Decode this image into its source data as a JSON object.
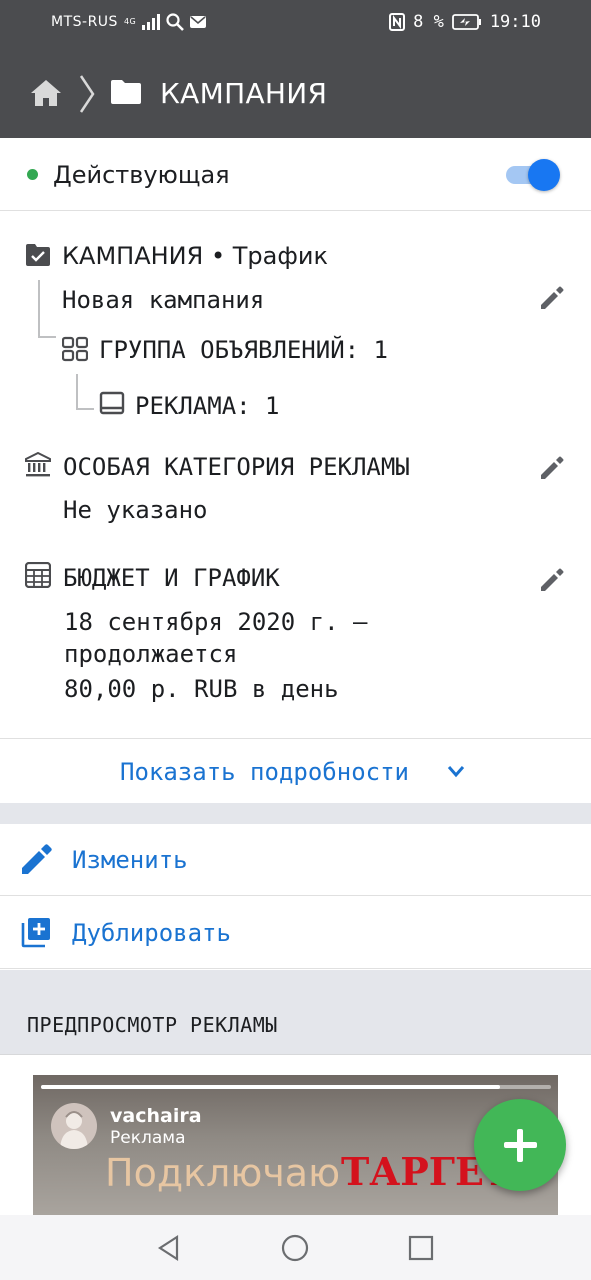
{
  "status_bar": {
    "carrier": "MTS-RUS",
    "net": "4G",
    "battery_pct": "8 %",
    "time": "19:10"
  },
  "app_bar": {
    "title": "КАМПАНИЯ"
  },
  "campaign_status": {
    "label": "Действующая",
    "enabled": true,
    "accent": "#1877f2",
    "dot_color": "#33a852"
  },
  "campaign": {
    "heading": "КАМПАНИЯ",
    "separator": "•",
    "objective": "Трафик",
    "name": "Новая кампания",
    "ad_group_label": "ГРУППА ОБЪЯВЛЕНИЙ: 1",
    "ad_label": "РЕКЛАМА: 1"
  },
  "special_category": {
    "heading": "ОСОБАЯ КАТЕГОРИЯ РЕКЛАМЫ",
    "value": "Не указано"
  },
  "budget": {
    "heading": "БЮДЖЕТ И ГРАФИК",
    "schedule_line1": "18 сентября 2020 г. —",
    "schedule_line2": "продолжается",
    "amount": "80,00 р. RUB в день"
  },
  "show_details": "Показать подробности",
  "actions": {
    "edit": "Изменить",
    "duplicate": "Дублировать"
  },
  "preview": {
    "header": "ПРЕДПРОСМОТР РЕКЛАМЫ",
    "account": "vachaira",
    "sponsored": "Реклама",
    "caption_part1": "Подключаю",
    "caption_part2": "ТАРГЕТ",
    "progress": 0.9
  },
  "colors": {
    "link": "#1a73d1",
    "fab": "#42b757",
    "appbar": "#4b4c4f"
  }
}
